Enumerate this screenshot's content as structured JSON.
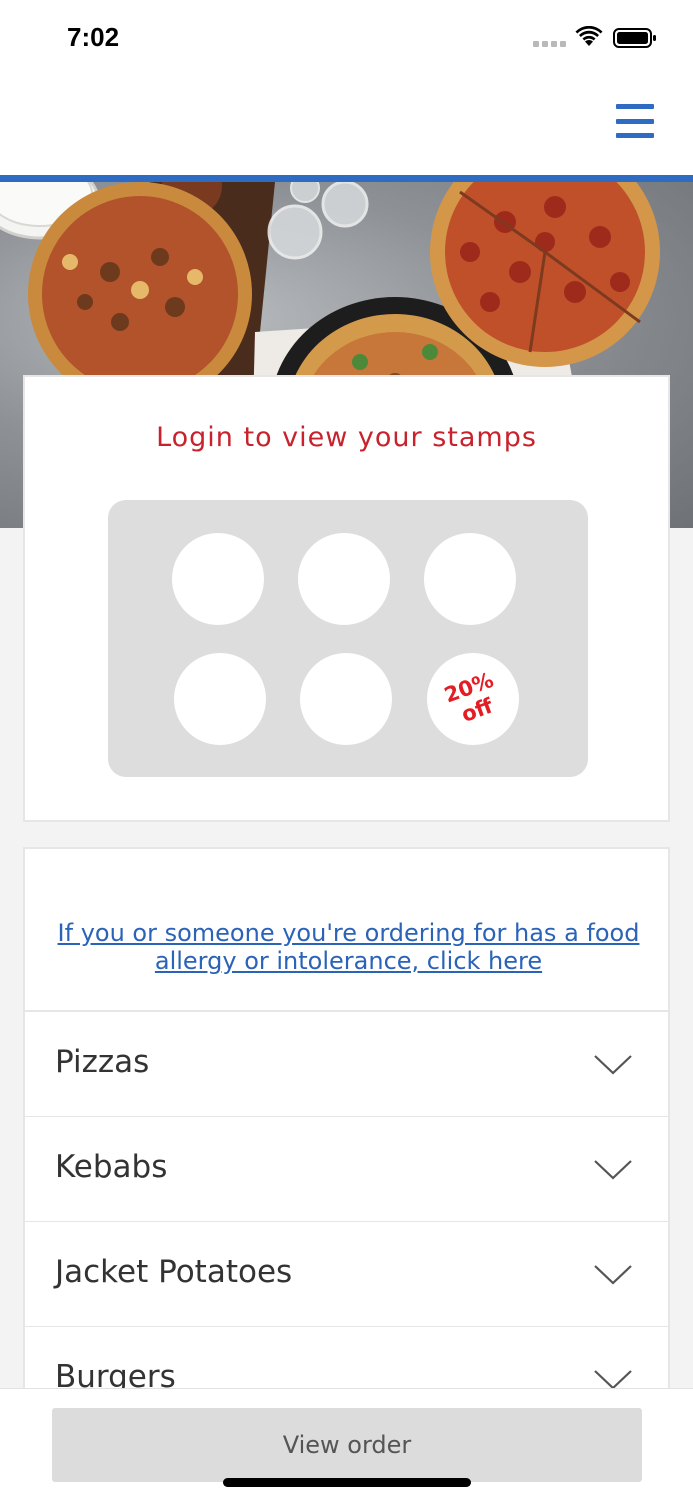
{
  "status_bar": {
    "time": "7:02"
  },
  "header": {
    "menu_icon": "hamburger-menu-icon",
    "accent_color": "#2e6cc4"
  },
  "stamp_card": {
    "title": "Login to view your stamps",
    "title_color": "#c8232c",
    "reward_label": "20%\noff",
    "reward_color": "#e41c23",
    "stamps_total": 6,
    "stamps_collected": 0
  },
  "allergy": {
    "link_text": "If you or someone you're ordering for has a food allergy or intolerance, click here",
    "link_color": "#2a63b8"
  },
  "categories": [
    {
      "label": "Pizzas"
    },
    {
      "label": "Kebabs"
    },
    {
      "label": "Jacket Potatoes"
    },
    {
      "label": "Burgers"
    }
  ],
  "footer": {
    "view_order_label": "View order"
  }
}
